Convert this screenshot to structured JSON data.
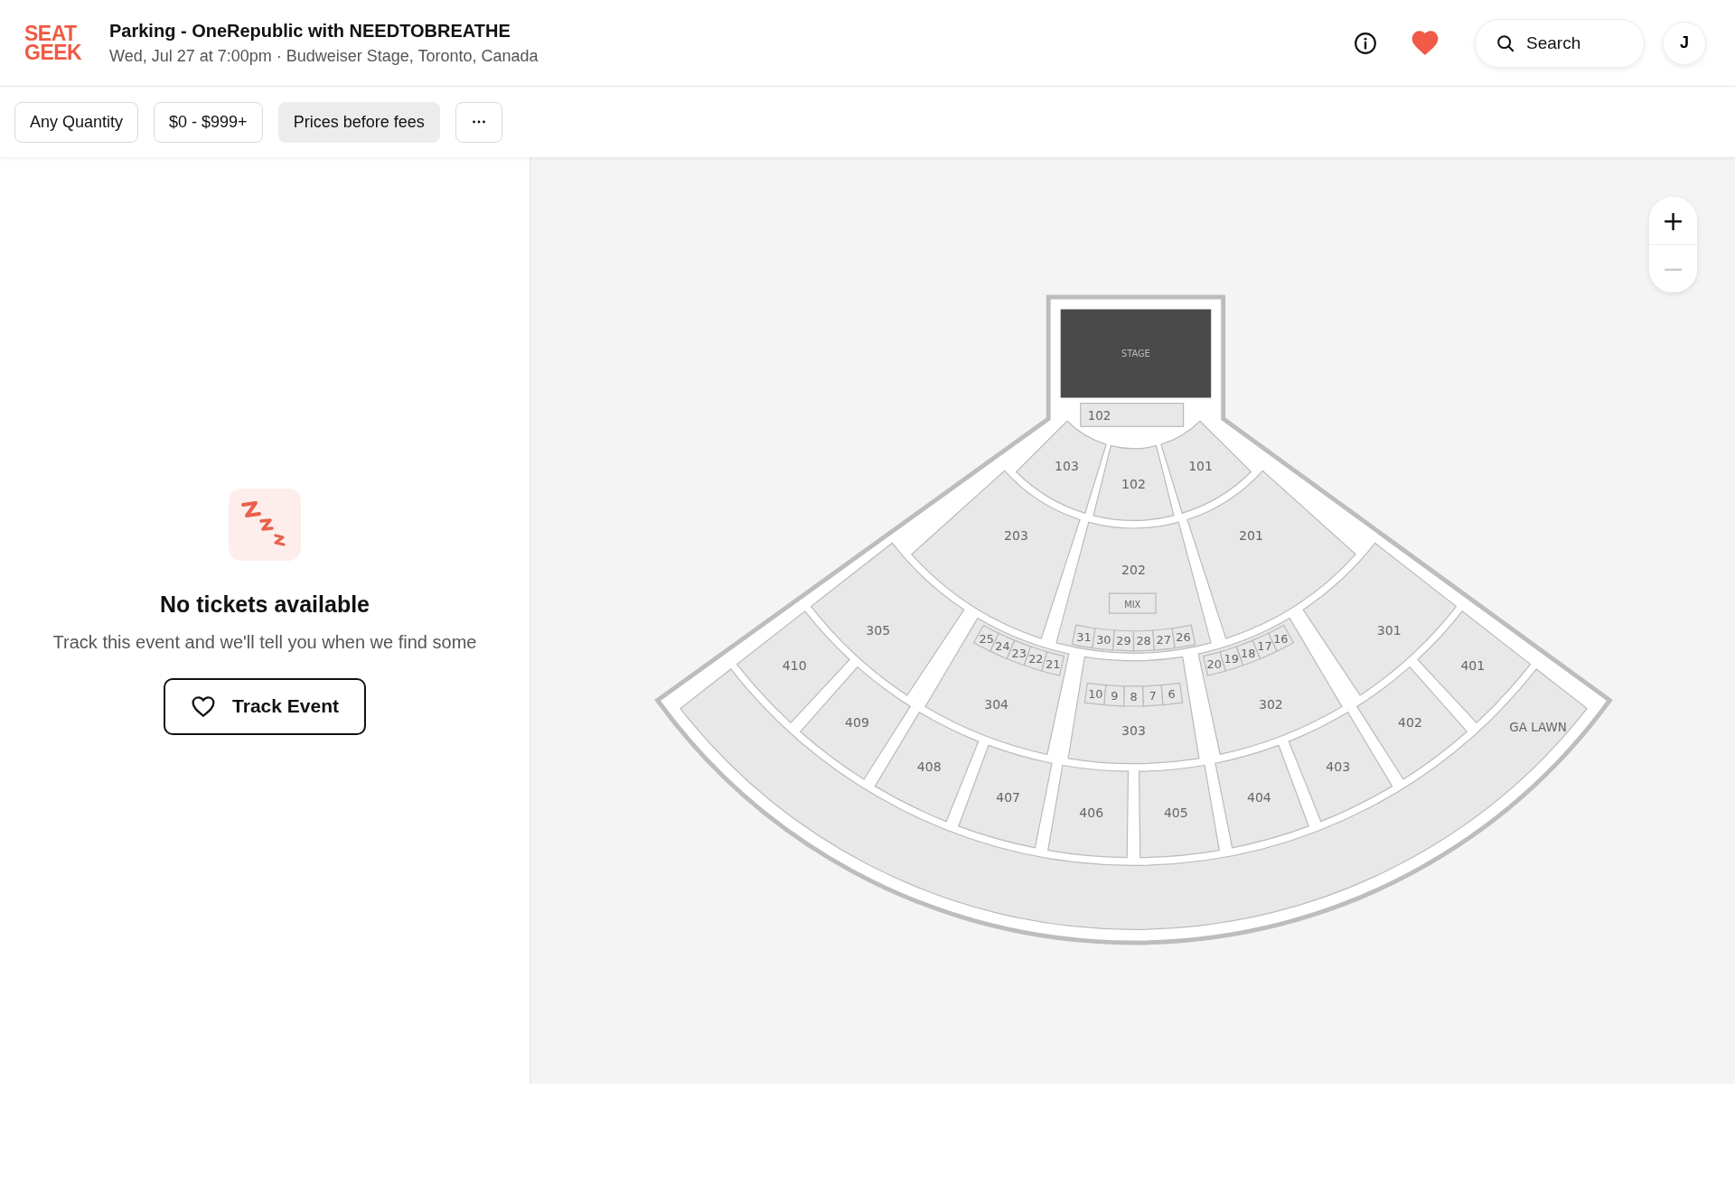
{
  "header": {
    "logo": [
      "SEAT",
      "GEEK"
    ],
    "title": "Parking - OneRepublic with NEEDTOBREATHE",
    "subtitle": "Wed, Jul 27 at 7:00pm · Budweiser Stage, Toronto, Canada",
    "favorite": true,
    "search_label": "Search",
    "avatar_initial": "J"
  },
  "filters": [
    {
      "label": "Any Quantity",
      "selected": false
    },
    {
      "label": "$0 - $999+",
      "selected": false
    },
    {
      "label": "Prices before fees",
      "selected": true
    }
  ],
  "empty_state": {
    "title": "No tickets available",
    "message": "Track this event and we'll tell you when we find some",
    "button": "Track Event"
  },
  "zoom_controls": [
    {
      "symbol": "+",
      "disabled": false
    },
    {
      "symbol": "−",
      "disabled": true
    }
  ],
  "map": {
    "stage": "STAGE",
    "pit": "102",
    "mix": "MIX",
    "lawn": "GA LAWN",
    "rings": [
      {
        "sections": [
          "103",
          "102",
          "101"
        ]
      },
      {
        "sections": [
          "203",
          "202",
          "201"
        ]
      },
      {
        "sections": [
          "305",
          "304",
          "303",
          "302",
          "301"
        ]
      },
      {
        "sections": [
          "410",
          "409",
          "408",
          "407",
          "406",
          "405",
          "404",
          "403",
          "402",
          "401"
        ]
      }
    ],
    "rows": [
      {
        "seats": [
          "25",
          "24",
          "23",
          "22",
          "21"
        ]
      },
      {
        "seats": [
          "31",
          "30",
          "29",
          "28",
          "27",
          "26"
        ]
      },
      {
        "seats": [
          "20",
          "19",
          "18",
          "17",
          "16"
        ]
      },
      {
        "seats": [
          "10",
          "9",
          "8",
          "7",
          "6"
        ]
      }
    ]
  }
}
